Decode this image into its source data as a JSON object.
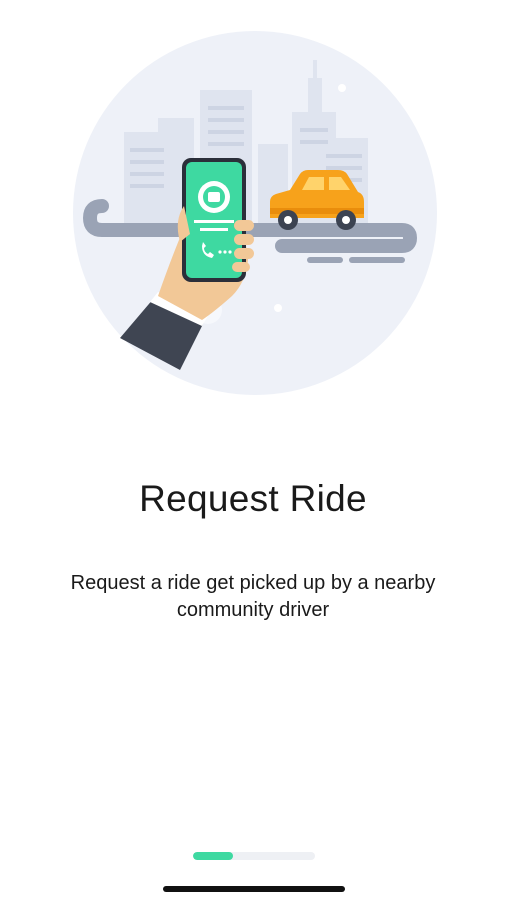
{
  "onboarding": {
    "title": "Request Ride",
    "description": "Request a ride get picked up by a nearby community driver",
    "illustration_icon": "hand-phone-car-city-illustration",
    "progress": 0.33
  },
  "colors": {
    "accent": "#3ed9a1",
    "car": "#f7a21b",
    "phone": "#3ed9a1",
    "circle_bg": "#eef1f8",
    "track": "#eef0f4"
  }
}
